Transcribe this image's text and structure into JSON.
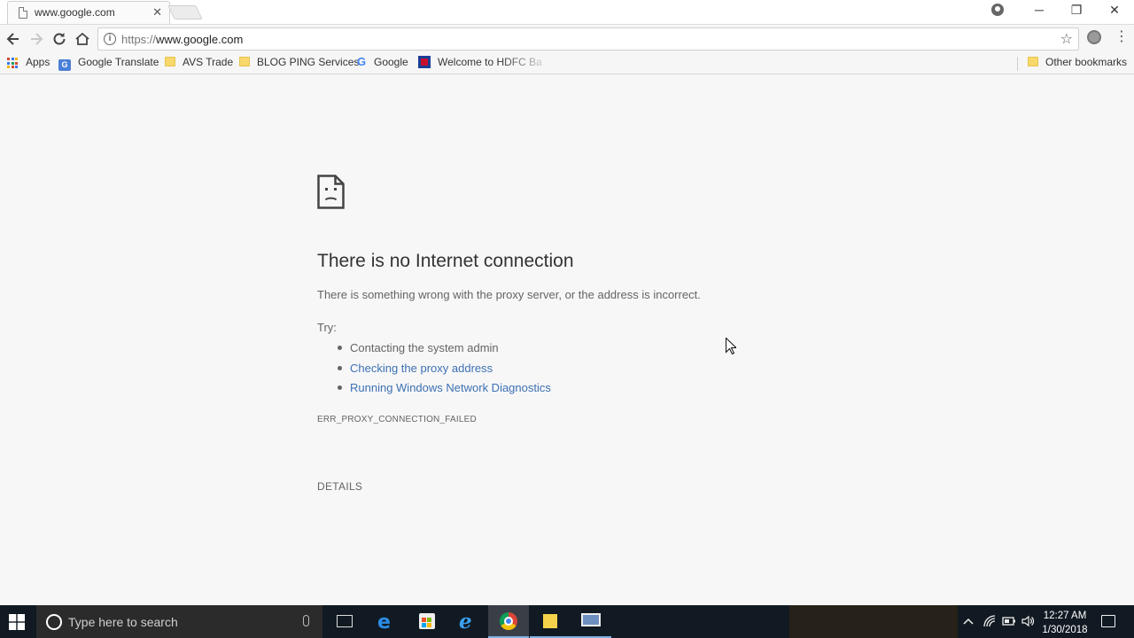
{
  "browser": {
    "tab": {
      "title": "www.google.com",
      "close_glyph": "✕"
    },
    "window_controls": {
      "minimize": "─",
      "restore": "❐",
      "close": "✕"
    },
    "omnibox": {
      "scheme": "https://",
      "host": "www.google.com"
    },
    "bookmarks": [
      {
        "label": "Apps",
        "icon": "apps-grid-icon"
      },
      {
        "label": "Google Translate",
        "icon": "google-translate-icon"
      },
      {
        "label": "AVS Trade",
        "icon": "folder-icon"
      },
      {
        "label": "BLOG PING Services",
        "icon": "folder-icon"
      },
      {
        "label": "Google",
        "icon": "google-g-icon"
      },
      {
        "label": "Welcome to HDFC Ba",
        "icon": "hdfc-icon"
      }
    ],
    "other_bookmarks": "Other bookmarks"
  },
  "error_page": {
    "title": "There is no Internet connection",
    "description": "There is something wrong with the proxy server, or the address is incorrect.",
    "try_label": "Try:",
    "suggestions": [
      {
        "text": "Contacting the system admin",
        "is_link": false
      },
      {
        "text": "Checking the proxy address",
        "is_link": true
      },
      {
        "text": "Running Windows Network Diagnostics",
        "is_link": true
      }
    ],
    "error_code": "ERR_PROXY_CONNECTION_FAILED",
    "details_button": "DETAILS",
    "link_color": "#3d70b2"
  },
  "taskbar": {
    "search_placeholder": "Type here to search",
    "apps": [
      "task-view-icon",
      "edge-icon",
      "store-icon",
      "internet-explorer-icon",
      "chrome-icon",
      "sticky-notes-icon",
      "remote-desktop-icon"
    ],
    "clock": {
      "time": "12:27 AM",
      "date": "1/30/2018"
    }
  }
}
